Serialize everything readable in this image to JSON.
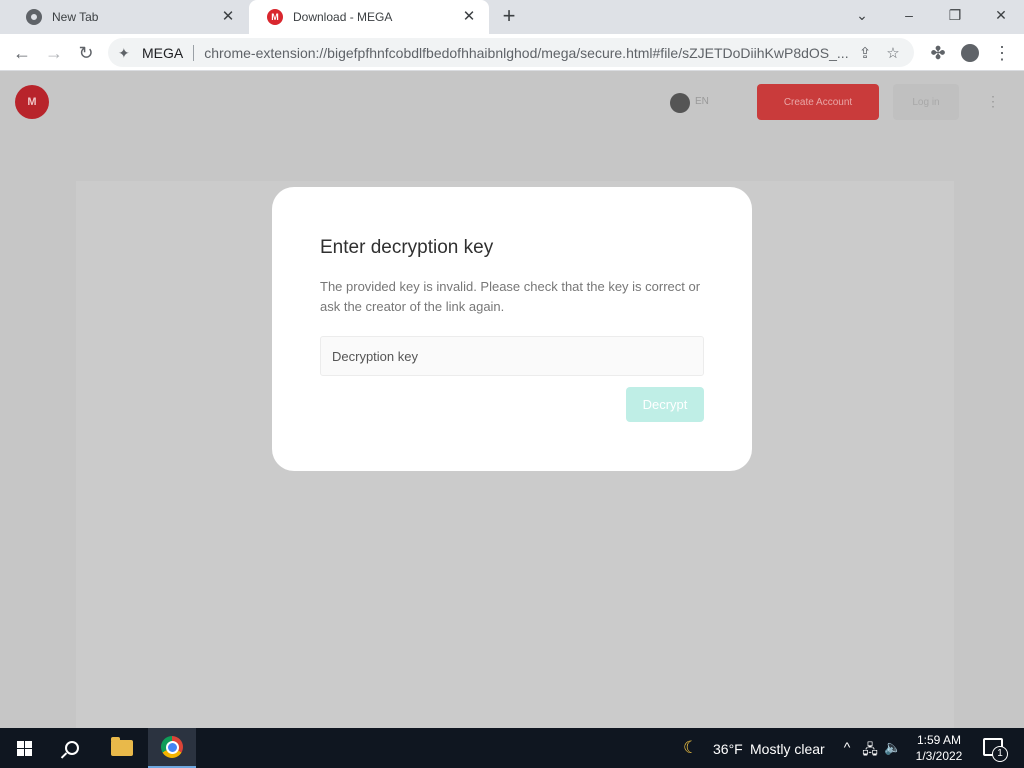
{
  "browser": {
    "tabs": [
      {
        "title": "New Tab",
        "favicon": "chrome-icon"
      },
      {
        "title": "Download - MEGA",
        "favicon": "mega-icon"
      }
    ],
    "new_tab": "+",
    "window_controls": {
      "dropdown": "⌄",
      "minimize": "–",
      "restore": "❐",
      "close": "✕"
    },
    "nav": {
      "back": "←",
      "forward": "→",
      "reload": "↻"
    },
    "address": {
      "site": "MEGA",
      "url": "chrome-extension://bigefpfhnfcobdlfbedofhhaibnlghod/mega/secure.html#file/sZJETDoDiihKwP8dOS_..."
    }
  },
  "mega_header": {
    "logo_text": "M",
    "theme_label": "EN",
    "create_account": "Create Account",
    "login": "Log in",
    "more": "⋮"
  },
  "dialog": {
    "title": "Enter decryption key",
    "message": "The provided key is invalid. Please check that the key is correct or ask the creator of the link again.",
    "input_placeholder": "Decryption key",
    "input_value": "",
    "button": "Decrypt",
    "button_color": "#bfeee6"
  },
  "taskbar": {
    "weather": {
      "icon": "moon-icon",
      "temp": "36°F",
      "condition": "Mostly clear"
    },
    "tray": {
      "chevron": "^",
      "network": "🖧",
      "volume": "🔈"
    },
    "time": "1:59 AM",
    "date": "1/3/2022",
    "notifications": "1"
  },
  "colors": {
    "mega_red": "#d9272e",
    "decrypt_teal": "#bfeee6",
    "taskbar": "#0f1620"
  }
}
